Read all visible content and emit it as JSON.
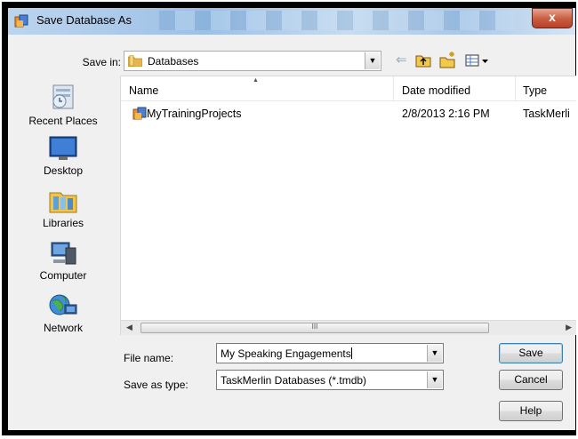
{
  "window": {
    "title": "Save Database As",
    "close_glyph": "x"
  },
  "toolbar": {
    "save_in_label": "Save in:",
    "save_in_value": "Databases",
    "icons": [
      "back-arrow-icon",
      "up-folder-icon",
      "new-folder-icon",
      "views-menu-icon"
    ]
  },
  "places": [
    {
      "label": "Recent Places",
      "icon": "recent-places-icon"
    },
    {
      "label": "Desktop",
      "icon": "desktop-icon"
    },
    {
      "label": "Libraries",
      "icon": "libraries-icon"
    },
    {
      "label": "Computer",
      "icon": "computer-icon"
    },
    {
      "label": "Network",
      "icon": "network-icon"
    }
  ],
  "file_list": {
    "columns": [
      "Name",
      "Date modified",
      "Type"
    ],
    "rows": [
      {
        "name": "MyTrainingProjects",
        "date_modified": "2/8/2013 2:16 PM",
        "type": "TaskMerli"
      }
    ],
    "scroll_thumb_glyph": "III"
  },
  "form": {
    "file_name_label": "File name:",
    "file_name_value": "My Speaking Engagements",
    "save_as_type_label": "Save as type:",
    "save_as_type_value": "TaskMerlin Databases (*.tmdb)"
  },
  "buttons": {
    "save": "Save",
    "cancel": "Cancel",
    "help": "Help"
  },
  "colors": {
    "title_bar": "#b5cfea",
    "close_button": "#c75b3f",
    "dialog_bg": "#f0f0f0",
    "default_button_border": "#3c7fb1"
  }
}
